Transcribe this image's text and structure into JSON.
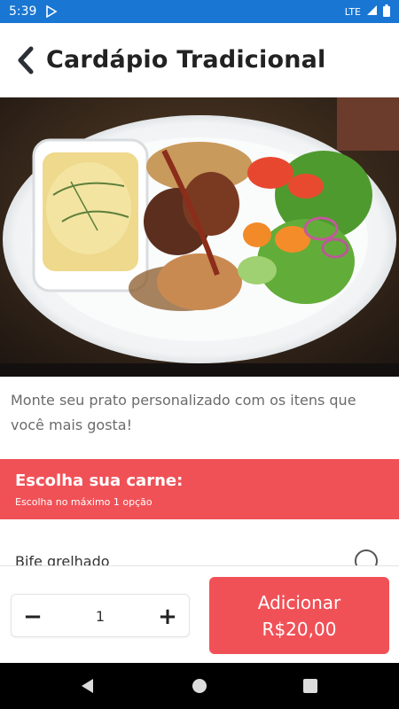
{
  "status_bar": {
    "time": "5:39",
    "network": "LTE",
    "icons": [
      "play-store-icon",
      "signal-icon",
      "battery-icon"
    ]
  },
  "header": {
    "title": "Cardápio Tradicional",
    "back_icon": "chevron-left-icon"
  },
  "hero": {
    "image": "plate-of-food-photo"
  },
  "description": "Monte seu prato personalizado com os itens que você mais gosta!",
  "section": {
    "title": "Escolha sua carne:",
    "subtitle": "Escolha no máximo 1 opção",
    "options": [
      {
        "label": "Bife grelhado",
        "selected": false
      }
    ]
  },
  "footer": {
    "quantity": "1",
    "minus_label": "−",
    "plus_label": "+",
    "add_label": "Adicionar",
    "price": "R$20,00"
  },
  "colors": {
    "status_bar": "#1976d2",
    "accent": "#f05157",
    "nav_bar": "#000000"
  },
  "nav_bar": {
    "icons": [
      "nav-back-icon",
      "nav-home-icon",
      "nav-recent-icon"
    ]
  }
}
